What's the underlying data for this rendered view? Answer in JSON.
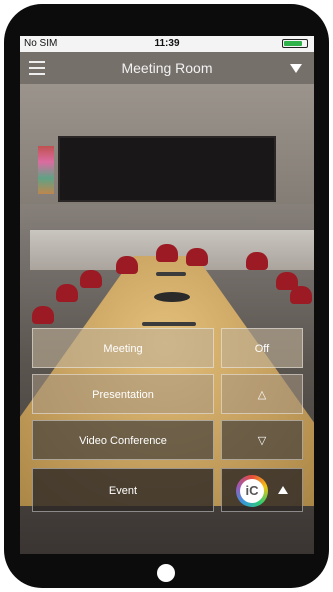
{
  "status_bar": {
    "carrier": "No SIM",
    "time": "11:39",
    "battery_level": 0.8
  },
  "nav": {
    "title": "Meeting Room",
    "menu_icon": "hamburger-menu-icon",
    "dropdown_icon": "triangle-down-icon"
  },
  "controls": {
    "meeting": "Meeting",
    "off": "Off",
    "presentation": "Presentation",
    "up_symbol": "△",
    "video_conference": "Video Conference",
    "down_symbol": "▽",
    "event": "Event"
  },
  "footer": {
    "logo_text": "iC",
    "expand_icon": "triangle-up-icon"
  },
  "colors": {
    "chair_red": "#9b1a24",
    "table_wood": "#caa462",
    "button_tint": "#a5967f"
  }
}
